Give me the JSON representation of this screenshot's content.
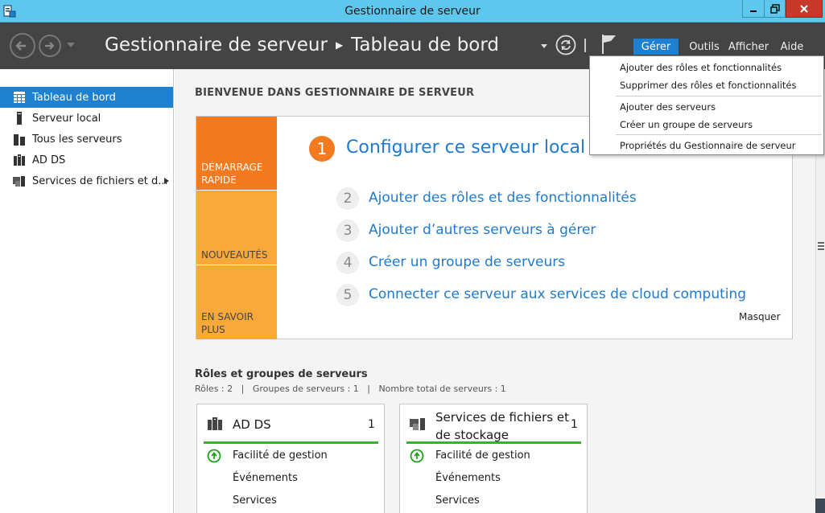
{
  "window": {
    "title": "Gestionnaire de serveur",
    "controls": {
      "minimize": "minimize-icon",
      "maximize": "restore-icon",
      "close": "close-icon"
    }
  },
  "header": {
    "breadcrumb": [
      "Gestionnaire de serveur",
      "Tableau de bord"
    ],
    "menus": [
      "Gérer",
      "Outils",
      "Afficher",
      "Aide"
    ],
    "active_menu": "Gérer",
    "colors": {
      "header_bg": "#444444",
      "accent": "#1e80d0",
      "titlebar": "#5ec7ee"
    }
  },
  "sidebar": {
    "items": [
      {
        "label": "Tableau de bord",
        "icon": "dashboard-icon",
        "active": true
      },
      {
        "label": "Serveur local",
        "icon": "server-icon"
      },
      {
        "label": "Tous les serveurs",
        "icon": "servers-icon"
      },
      {
        "label": "AD DS",
        "icon": "adds-icon"
      },
      {
        "label": "Services de fichiers et d...",
        "icon": "file-services-icon",
        "expandable": true
      }
    ]
  },
  "main": {
    "welcome_title": "BIENVENUE DANS GESTIONNAIRE DE SERVEUR",
    "quickstart": {
      "tiles": [
        "DÉMARRAGE RAPIDE",
        "NOUVEAUTÉS",
        "EN SAVOIR PLUS"
      ],
      "steps": [
        {
          "num": "1",
          "label": "Configurer ce serveur local"
        },
        {
          "num": "2",
          "label": "Ajouter des rôles et des fonctionnalités"
        },
        {
          "num": "3",
          "label": "Ajouter d’autres serveurs à gérer"
        },
        {
          "num": "4",
          "label": "Créer un groupe de serveurs"
        },
        {
          "num": "5",
          "label": "Connecter ce serveur aux services de cloud computing"
        }
      ],
      "hide_label": "Masquer"
    },
    "roles": {
      "title": "Rôles et groupes de serveurs",
      "counts": "Rôles : 2   |   Groupes de serveurs : 1   |   Nombre total de serveurs : 1",
      "cards": [
        {
          "title": "AD DS",
          "count": "1",
          "rows": [
            "Facilité de gestion",
            "Événements",
            "Services"
          ]
        },
        {
          "title": "Services de fichiers et de stockage",
          "title_line1": "Services de fichiers et",
          "title_line2": "de stockage",
          "count": "1",
          "rows": [
            "Facilité de gestion",
            "Événements",
            "Services"
          ]
        }
      ]
    }
  },
  "dropdown": {
    "items": [
      "Ajouter des rôles et fonctionnalités",
      "Supprimer des rôles et fonctionnalités",
      "Ajouter des serveurs",
      "Créer un groupe de serveurs",
      "Propriétés du Gestionnaire de serveur"
    ]
  }
}
